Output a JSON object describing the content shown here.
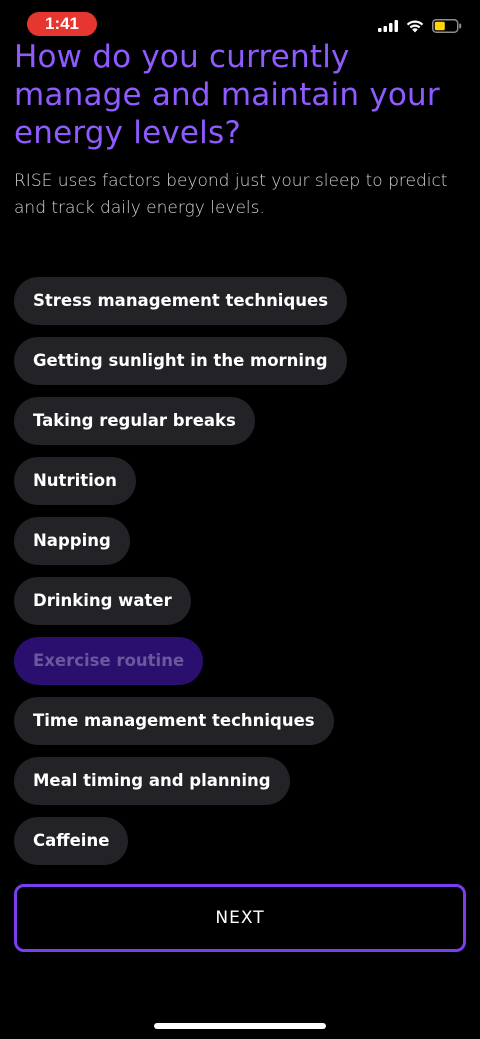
{
  "status_bar": {
    "time": "1:41",
    "accent_color": "#e5362f",
    "icons": [
      "cellular-signal-icon",
      "wifi-icon",
      "battery-icon"
    ],
    "battery_color": "#ffd60a"
  },
  "heading": "How do you currently manage and maintain your energy levels?",
  "subtitle": "RISE uses factors beyond just your sleep to predict and track daily energy levels.",
  "options": [
    {
      "label": "Stress management techniques",
      "selected": false
    },
    {
      "label": "Getting sunlight in the morning",
      "selected": false
    },
    {
      "label": "Taking regular breaks",
      "selected": false
    },
    {
      "label": "Nutrition",
      "selected": false
    },
    {
      "label": "Napping",
      "selected": false
    },
    {
      "label": "Drinking water",
      "selected": false
    },
    {
      "label": "Exercise routine",
      "selected": true
    },
    {
      "label": "Time management techniques",
      "selected": false
    },
    {
      "label": "Meal timing and planning",
      "selected": false
    },
    {
      "label": "Caffeine",
      "selected": false
    }
  ],
  "next_label": "NEXT",
  "colors": {
    "heading": "#8f5bff",
    "chip_bg": "#232226",
    "chip_selected_bg": "#2a0f6e",
    "button_border": "#7a3df2"
  }
}
